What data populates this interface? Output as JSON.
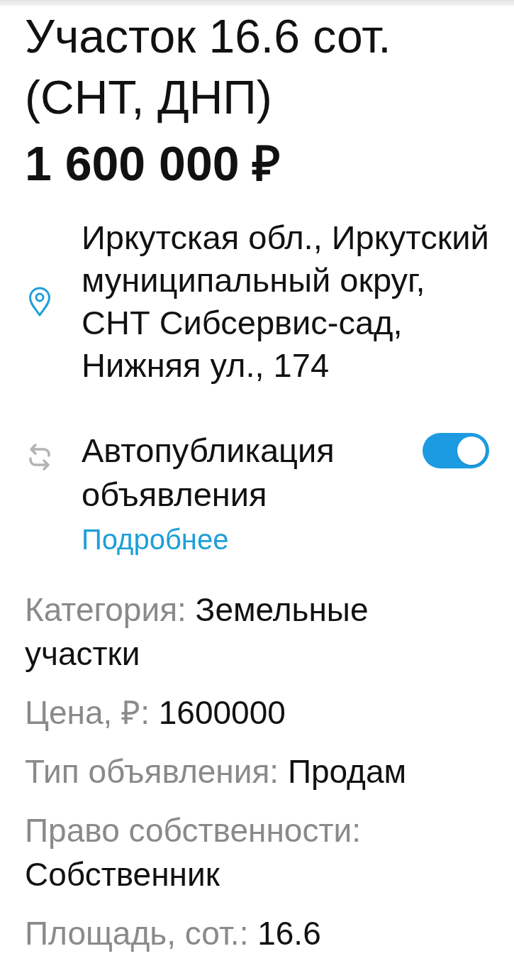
{
  "listing": {
    "title": "Участок 16.6 сот. (СНТ, ДНП)",
    "price": "1 600 000 ₽"
  },
  "address": {
    "text": "Иркутская обл., Иркутский муниципальный округ, СНТ Сибсервис-сад, Нижняя ул., 174"
  },
  "autopublish": {
    "label": "Автопубликация объявления",
    "on": true,
    "link": "Подробнее"
  },
  "details": [
    {
      "label": "Категория:",
      "value": "Земельные участки"
    },
    {
      "label": "Цена, ₽:",
      "value": "1600000"
    },
    {
      "label": "Тип объявления:",
      "value": "Продам"
    },
    {
      "label": "Право собственности:",
      "value": "Собственник"
    },
    {
      "label": "Площадь, сот.:",
      "value": "16.6"
    }
  ]
}
